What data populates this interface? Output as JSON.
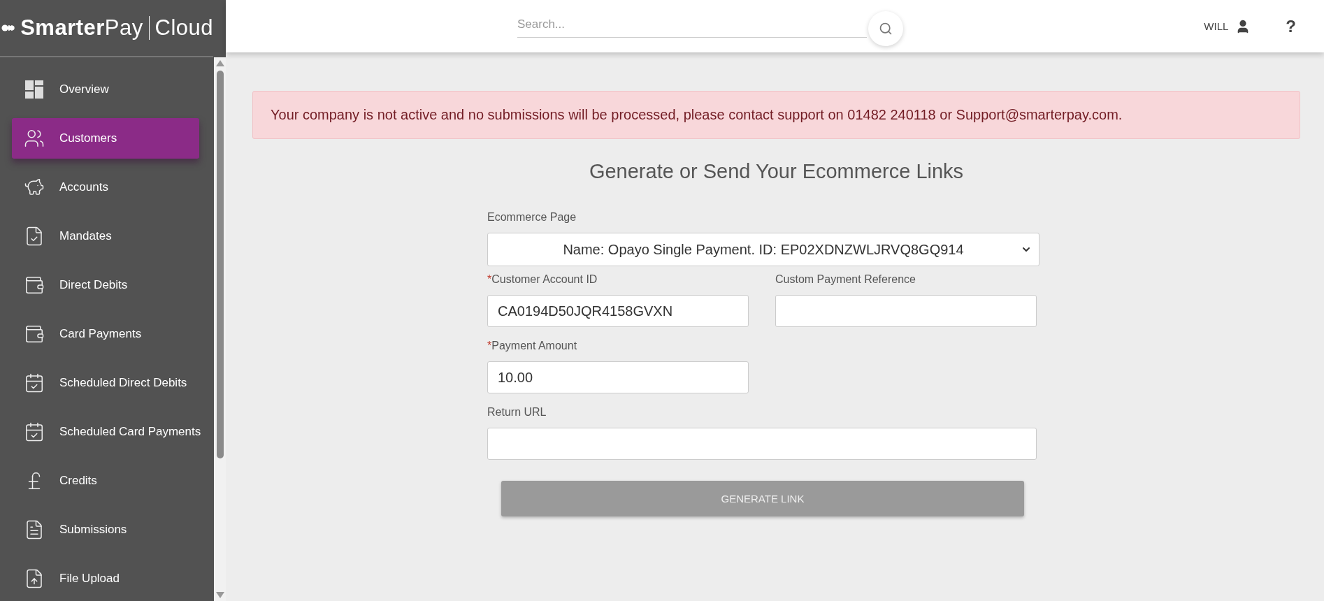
{
  "logo": {
    "brand": "**Smarter**Pay",
    "product": "Cloud"
  },
  "sidebar": {
    "items": [
      {
        "label": "Overview",
        "selected": false
      },
      {
        "label": "Customers",
        "selected": true
      },
      {
        "label": "Accounts",
        "selected": false
      },
      {
        "label": "Mandates",
        "selected": false
      },
      {
        "label": "Direct Debits",
        "selected": false
      },
      {
        "label": "Card Payments",
        "selected": false
      },
      {
        "label": "Scheduled Direct Debits",
        "selected": false
      },
      {
        "label": "Scheduled Card Payments",
        "selected": false
      },
      {
        "label": "Credits",
        "selected": false
      },
      {
        "label": "Submissions",
        "selected": false
      },
      {
        "label": "File Upload",
        "selected": false
      }
    ]
  },
  "header": {
    "search": {
      "placeholder": "Search..."
    },
    "user": "WILL",
    "help": "?"
  },
  "alert": "Your company is not active and no submissions will be processed, please contact support on 01482 240118 or Support@smarterpay.com.",
  "title": "Generate or Send Your Ecommerce Links",
  "form": {
    "select": {
      "label": "Ecommerce Page",
      "value": "Name: Opayo Single Payment. ID: EP02XDNZWLJRVQ8GQ914"
    },
    "fields": [
      {
        "label": "Customer Account ID",
        "required_mark": "*",
        "value": "CA0194D50JQR4158GVXN"
      },
      {
        "label": "Custom Payment Reference"
      },
      {
        "label": "Payment Amount",
        "required_mark": "*",
        "value": "10.00"
      },
      {
        "label": "Return URL"
      }
    ],
    "button": {
      "label": "GENERATE LINK",
      "disabled": true
    }
  }
}
